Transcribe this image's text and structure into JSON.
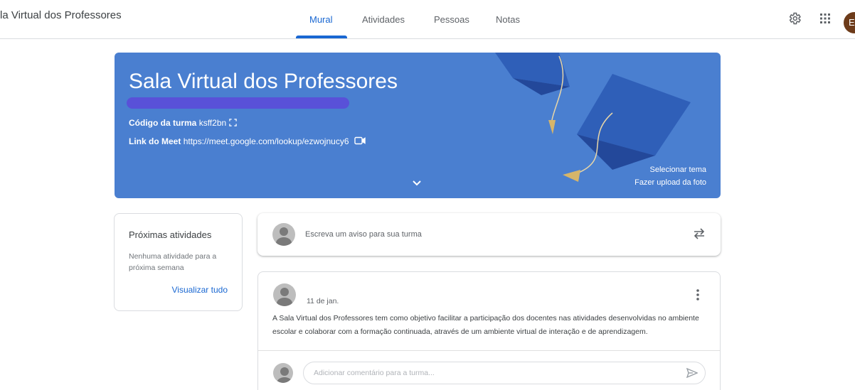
{
  "header": {
    "app_title": "la Virtual dos Professores",
    "tabs": [
      {
        "label": "Mural",
        "active": true
      },
      {
        "label": "Atividades",
        "active": false
      },
      {
        "label": "Pessoas",
        "active": false
      },
      {
        "label": "Notas",
        "active": false
      }
    ],
    "settings_icon": "gear-icon",
    "apps_icon": "apps-grid-icon",
    "avatar_initial": "E"
  },
  "banner": {
    "title": "Sala Virtual dos Professores",
    "class_code_label": "Código da turma",
    "class_code": "ksff2bn",
    "meet_label": "Link do Meet",
    "meet_url": "https://meet.google.com/lookup/ezwojnucy6",
    "select_theme": "Selecionar tema",
    "upload_photo": "Fazer upload da foto",
    "color": "#4a7fd0"
  },
  "upcoming": {
    "title": "Próximas atividades",
    "empty_text": "Nenhuma atividade para a próxima semana",
    "view_all": "Visualizar tudo"
  },
  "announce": {
    "placeholder": "Escreva um aviso para sua turma"
  },
  "post": {
    "date": "11 de jan.",
    "body": "A Sala Virtual dos Professores tem como objetivo facilitar a participação dos docentes nas atividades desenvolvidas no ambiente escolar e colaborar com a formação continuada, através de um ambiente virtual de interação e de aprendizagem.",
    "comment_placeholder": "Adicionar comentário para a turma..."
  },
  "colors": {
    "accent": "#1967d2",
    "scribble": "#5a4fd8"
  }
}
